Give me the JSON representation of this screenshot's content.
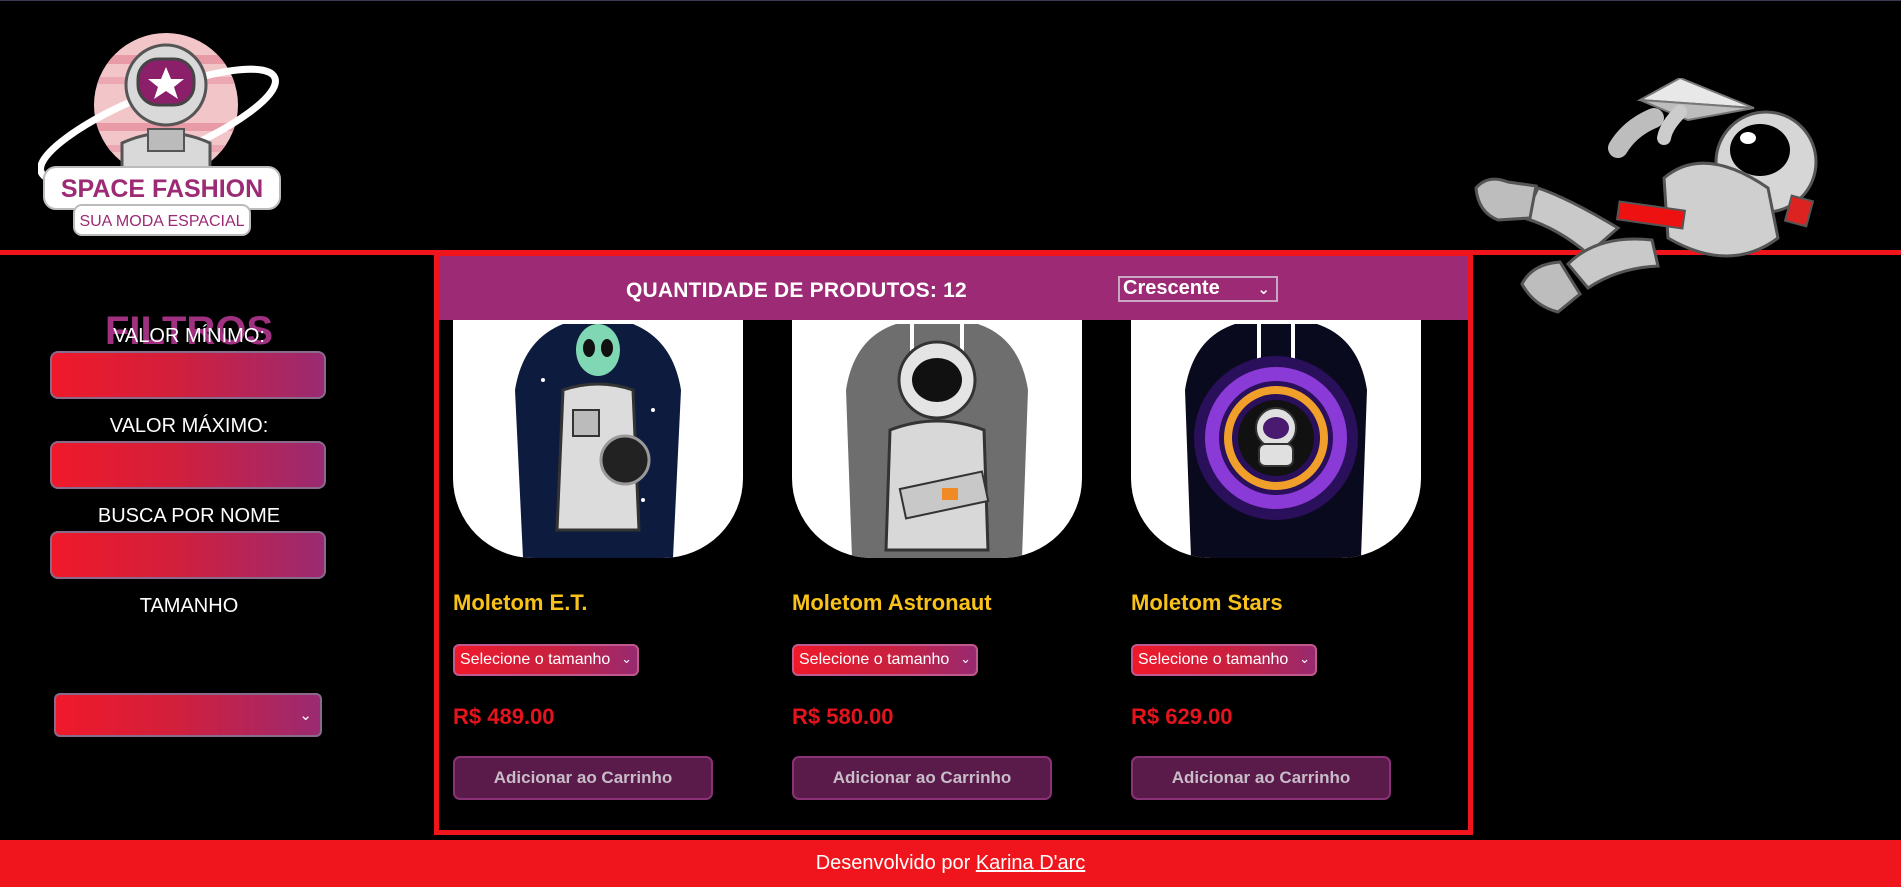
{
  "header": {
    "logo_title": "SPACE FASHION",
    "logo_subtitle": "SUA MODA ESPACIAL"
  },
  "filters": {
    "title": "FILTROS",
    "min_label": "VALOR MÍNIMO:",
    "max_label": "VALOR MÁXIMO:",
    "name_label": "BUSCA POR NOME",
    "size_label": "TAMANHO",
    "min_value": "",
    "max_value": "",
    "name_value": ""
  },
  "products_bar": {
    "count_text": "QUANTIDADE DE PRODUTOS: 12",
    "sort_selected": "Crescente"
  },
  "products": [
    {
      "name": "Moletom E.T.",
      "size_placeholder": "Selecione o tamanho",
      "price": "R$ 489.00",
      "button": "Adicionar ao Carrinho"
    },
    {
      "name": "Moletom Astronaut",
      "size_placeholder": "Selecione o tamanho",
      "price": "R$ 580.00",
      "button": "Adicionar ao Carrinho"
    },
    {
      "name": "Moletom Stars",
      "size_placeholder": "Selecione o tamanho",
      "price": "R$ 629.00",
      "button": "Adicionar ao Carrinho"
    }
  ],
  "footer": {
    "prefix": "Desenvolvido por",
    "author": "Karina D'arc"
  },
  "colors": {
    "accent_red": "#f0151c",
    "accent_purple": "#9c2a74",
    "title_purple": "#a03080",
    "product_name_yellow": "#f8c21a",
    "price_red": "#e5141c"
  },
  "icons": [
    "space-fashion-logo",
    "astronaut-paper-plane-illustration",
    "chevron-down-icon"
  ]
}
